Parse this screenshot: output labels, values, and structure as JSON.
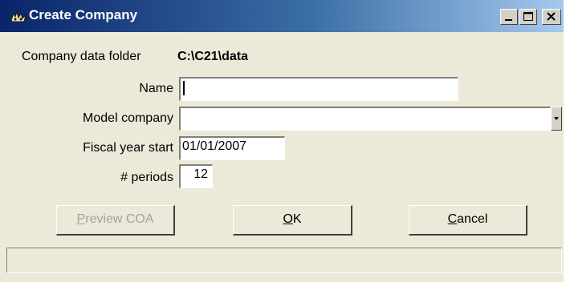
{
  "window": {
    "title": "Create Company",
    "controls": {
      "minimize": "minimize-button",
      "maximize": "maximize-button",
      "close": "close-button"
    }
  },
  "form": {
    "data_folder_label": "Company data folder",
    "data_folder_value": "C:\\C21\\data",
    "name_label": "Name",
    "name_value": "",
    "model_label": "Model company",
    "model_value": "",
    "fiscal_label": "Fiscal year start",
    "fiscal_value": "01/01/2007",
    "periods_label": "# periods",
    "periods_value": "12"
  },
  "buttons": {
    "preview": {
      "first": "P",
      "rest": "review COA",
      "enabled": false
    },
    "ok": {
      "first": "O",
      "rest": "K",
      "enabled": true
    },
    "cancel": {
      "first": "C",
      "rest": "ancel",
      "enabled": true
    }
  },
  "status_bar": {
    "text": ""
  }
}
